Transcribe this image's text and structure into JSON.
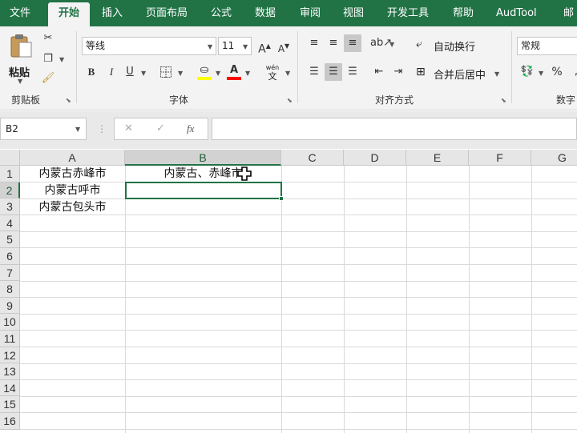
{
  "ribbon_tabs": [
    "文件",
    "开始",
    "插入",
    "页面布局",
    "公式",
    "数据",
    "审阅",
    "视图",
    "开发工具",
    "帮助",
    "AudTool",
    "邮"
  ],
  "clipboard": {
    "paste_label": "粘贴",
    "group_label": "剪贴板"
  },
  "font": {
    "name": "等线",
    "size": "11",
    "bold": "B",
    "italic": "I",
    "underline": "U",
    "grow": "A",
    "shrink": "A",
    "phonetic": "wén",
    "phonetic_sub": "文",
    "group_label": "字体",
    "fill_color": "#ffff00",
    "font_color": "#ff0000"
  },
  "alignment": {
    "wrap_label": "自动换行",
    "merge_label": "合并后居中",
    "group_label": "对齐方式"
  },
  "number": {
    "format": "常规",
    "percent": "%",
    "group_label": "数字"
  },
  "formula_bar": {
    "name_box": "B2",
    "cancel": "✕",
    "enter": "✓",
    "fx": "fx",
    "formula": ""
  },
  "columns": [
    "A",
    "B",
    "C",
    "D",
    "E",
    "F",
    "G"
  ],
  "rows": [
    "1",
    "2",
    "3",
    "4",
    "5",
    "6",
    "7",
    "8",
    "9",
    "10",
    "11",
    "12",
    "13",
    "14",
    "15",
    "16"
  ],
  "cells": {
    "A1": "内蒙古赤峰市",
    "A2": "内蒙古呼市",
    "A3": "内蒙古包头市",
    "B1": "内蒙古、赤峰市"
  },
  "selection": {
    "active_cell": "B2",
    "accent": "#217346"
  }
}
